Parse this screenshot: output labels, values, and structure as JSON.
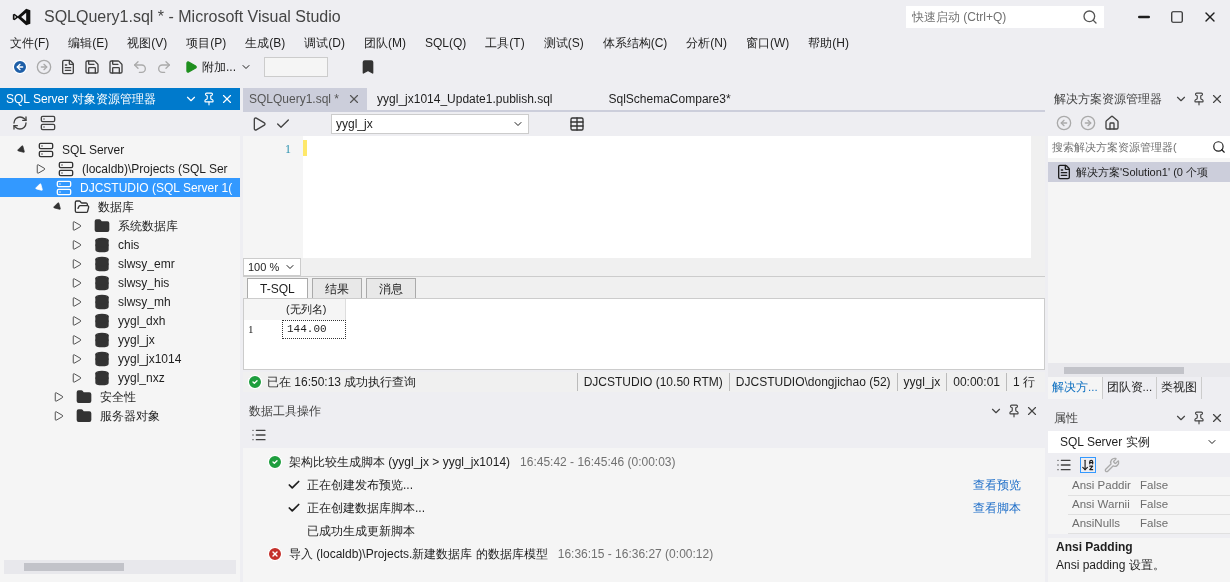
{
  "window": {
    "title": "SQLQuery1.sql * - Microsoft Visual Studio",
    "quick_launch": {
      "placeholder": "快速启动 (Ctrl+Q)"
    }
  },
  "menu": [
    "文件(F)",
    "编辑(E)",
    "视图(V)",
    "项目(P)",
    "生成(B)",
    "调试(D)",
    "团队(M)",
    "SQL(Q)",
    "工具(T)",
    "测试(S)",
    "体系结构(C)",
    "分析(N)",
    "窗口(W)",
    "帮助(H)"
  ],
  "toolbar": {
    "run_label": "附加..."
  },
  "object_explorer": {
    "title": "SQL Server 对象资源管理器",
    "tree": [
      {
        "label": "SQL Server",
        "kind": "root",
        "expanded": true,
        "selected": false,
        "children": [
          {
            "label": "(localdb)\\Projects (SQL Ser",
            "kind": "server",
            "expanded": false,
            "selected": false
          },
          {
            "label": "DJCSTUDIO (SQL Server 1(",
            "kind": "server",
            "expanded": true,
            "selected": true,
            "children": [
              {
                "label": "数据库",
                "kind": "open-folder",
                "expanded": true,
                "selected": false,
                "children": [
                  {
                    "label": "系统数据库",
                    "kind": "folder",
                    "expanded": false,
                    "selected": false
                  },
                  {
                    "label": "chis",
                    "kind": "database",
                    "expanded": false,
                    "selected": false
                  },
                  {
                    "label": "slwsy_emr",
                    "kind": "database",
                    "expanded": false,
                    "selected": false
                  },
                  {
                    "label": "slwsy_his",
                    "kind": "database",
                    "expanded": false,
                    "selected": false
                  },
                  {
                    "label": "slwsy_mh",
                    "kind": "database",
                    "expanded": false,
                    "selected": false
                  },
                  {
                    "label": "yygl_dxh",
                    "kind": "database",
                    "expanded": false,
                    "selected": false
                  },
                  {
                    "label": "yygl_jx",
                    "kind": "database",
                    "expanded": false,
                    "selected": false
                  },
                  {
                    "label": "yygl_jx1014",
                    "kind": "database",
                    "expanded": false,
                    "selected": false
                  },
                  {
                    "label": "yygl_nxz",
                    "kind": "database",
                    "expanded": false,
                    "selected": false
                  }
                ]
              },
              {
                "label": "安全性",
                "kind": "folder",
                "expanded": false,
                "selected": false
              },
              {
                "label": "服务器对象",
                "kind": "folder",
                "expanded": false,
                "selected": false
              }
            ]
          }
        ]
      }
    ]
  },
  "editor": {
    "tabs": [
      {
        "label": "SQLQuery1.sql *",
        "selected": true
      },
      {
        "label": "yygl_jx1014_Update1.publish.sql",
        "selected": false
      },
      {
        "label": "SqlSchemaCompare3*",
        "selected": false
      }
    ],
    "database": "yygl_jx",
    "line_numbers": [
      "1"
    ],
    "zoom": "100 %",
    "result_tabs": [
      {
        "label": "T-SQL",
        "selected": true
      },
      {
        "label": "结果",
        "selected": false
      },
      {
        "label": "消息",
        "selected": false
      }
    ],
    "grid": {
      "columns": [
        "(无列名)"
      ],
      "rows": [
        {
          "number": "1",
          "cells": [
            "144.00"
          ]
        }
      ]
    },
    "status": {
      "message": "已在 16:50:13 成功执行查询",
      "cells": [
        "DJCSTUDIO (10.50 RTM)",
        "DJCSTUDIO\\dongjichao (52)",
        "yygl_jx",
        "00:00:01",
        "1 行"
      ]
    }
  },
  "data_tools": {
    "title": "数据工具操作",
    "operations": [
      {
        "kind": "success",
        "title": "架构比较生成脚本 (yygl_jx > yygl_jx1014)",
        "time": "16:45:42 - 16:45:46 (0:00:03)",
        "steps": [
          {
            "done": true,
            "text": "正在创建发布预览...",
            "link": "查看预览"
          },
          {
            "done": true,
            "text": "正在创建数据库脚本...",
            "link": "查看脚本"
          },
          {
            "done": false,
            "text": "已成功生成更新脚本"
          }
        ]
      },
      {
        "kind": "error",
        "title": "导入 (localdb)\\Projects.新建数据库 的数据库模型",
        "time": "16:36:15 - 16:36:27 (0:00:12)"
      }
    ]
  },
  "solution_explorer": {
    "title": "解决方案资源管理器",
    "search": {
      "placeholder": "搜索解决方案资源管理器("
    },
    "items": [
      {
        "label": "解决方案'Solution1' (0 个项",
        "selected": true
      }
    ],
    "tabs": [
      {
        "label": "解决方...",
        "selected": true
      },
      {
        "label": "团队资...",
        "selected": false
      },
      {
        "label": "类视图",
        "selected": false
      }
    ]
  },
  "properties": {
    "title": "属性",
    "object": "SQL Server 实例",
    "rows": [
      {
        "name": "Ansi Paddir",
        "value": "False"
      },
      {
        "name": "Ansi Warnii",
        "value": "False"
      },
      {
        "name": "AnsiNulls",
        "value": "False"
      }
    ],
    "description": {
      "title": "Ansi Padding",
      "text": "Ansi padding 设置。"
    }
  }
}
